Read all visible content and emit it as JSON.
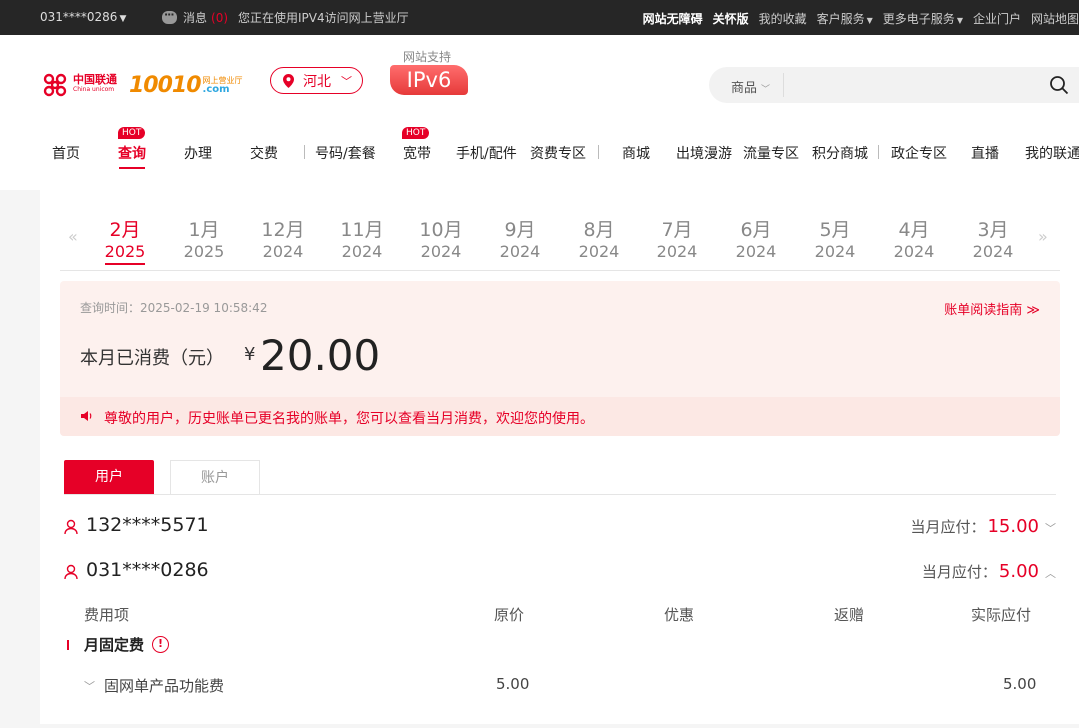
{
  "topbar": {
    "account": "031****0286",
    "message_label": "消息",
    "message_count": "(0)",
    "ipv4_notice": "您正在使用IPV4访问网上营业厅",
    "links": [
      "网站无障碍",
      "关怀版",
      "我的收藏",
      "客户服务",
      "更多电子服务",
      "企业门户",
      "网站地图"
    ]
  },
  "header": {
    "brand_cn": "中国联通",
    "brand_en": "China unicom",
    "brand_10010": "10010",
    "brand_wt": "网上营业厅",
    "brand_com": ".com",
    "region": "河北",
    "ipv6_support": "网站支持",
    "ipv6_badge": "IPv6",
    "search_category": "商品",
    "search_placeholder": ""
  },
  "nav": {
    "items": [
      "首页",
      "查询",
      "办理",
      "交费",
      "号码/套餐",
      "宽带",
      "手机/配件",
      "资费专区",
      "商城",
      "出境漫游",
      "流量专区",
      "积分商城",
      "政企专区",
      "直播",
      "我的联通"
    ],
    "hot_label": "HOT",
    "active": "查询"
  },
  "months": [
    {
      "m": "2月",
      "y": "2025"
    },
    {
      "m": "1月",
      "y": "2025"
    },
    {
      "m": "12月",
      "y": "2024"
    },
    {
      "m": "11月",
      "y": "2024"
    },
    {
      "m": "10月",
      "y": "2024"
    },
    {
      "m": "9月",
      "y": "2024"
    },
    {
      "m": "8月",
      "y": "2024"
    },
    {
      "m": "7月",
      "y": "2024"
    },
    {
      "m": "6月",
      "y": "2024"
    },
    {
      "m": "5月",
      "y": "2024"
    },
    {
      "m": "4月",
      "y": "2024"
    },
    {
      "m": "3月",
      "y": "2024"
    }
  ],
  "summary": {
    "query_time": "查询时间：2025-02-19 10:58:42",
    "guide_link": "账单阅读指南 ≫",
    "label": "本月已消费（元）",
    "currency": "¥",
    "amount": "20.00",
    "notice": "尊敬的用户，历史账单已更名我的账单，您可以查看当月消费，欢迎您的使用。"
  },
  "tabs": {
    "user": "用户",
    "account": "账户"
  },
  "lines": [
    {
      "number": "132****5571",
      "due_label": "当月应付：",
      "due_value": "15.00",
      "expanded": false
    },
    {
      "number": "031****0286",
      "due_label": "当月应付：",
      "due_value": "5.00",
      "expanded": true
    }
  ],
  "table": {
    "headers": [
      "费用项",
      "原价",
      "优惠",
      "返赠",
      "实际应付"
    ],
    "category": "月固定费",
    "category_info": "!",
    "rows": [
      {
        "name": "固网单产品功能费",
        "original": "5.00",
        "actual": "5.00"
      }
    ]
  },
  "colors": {
    "brand_red": "#e60027",
    "orange": "#f08a00"
  }
}
